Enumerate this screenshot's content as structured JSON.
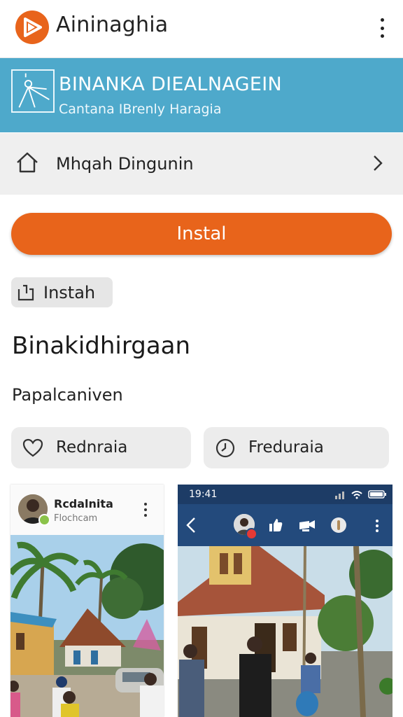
{
  "app": {
    "title": "Aininaghia"
  },
  "banner": {
    "title": "BINANKA DIEALNAGEIN",
    "subtitle": "Cantana IBrenly Haragia"
  },
  "nav": {
    "label": "Mhqah Dingunin"
  },
  "install_button": {
    "label": "Instal"
  },
  "chip": {
    "label": "Instah"
  },
  "section": {
    "title": "Binakidhirgaan",
    "subtitle": "Papalcaniven"
  },
  "actions": [
    {
      "label": "Rednraia",
      "icon": "heart-icon"
    },
    {
      "label": "Freduraia",
      "icon": "clock-icon"
    }
  ],
  "card1": {
    "name": "Rcdalnita",
    "subtitle": "Flochcam"
  },
  "card2": {
    "status_time": "19:41"
  },
  "colors": {
    "accent": "#e8641b",
    "banner": "#4ea9cb",
    "header_dark": "#1f3f6b"
  }
}
